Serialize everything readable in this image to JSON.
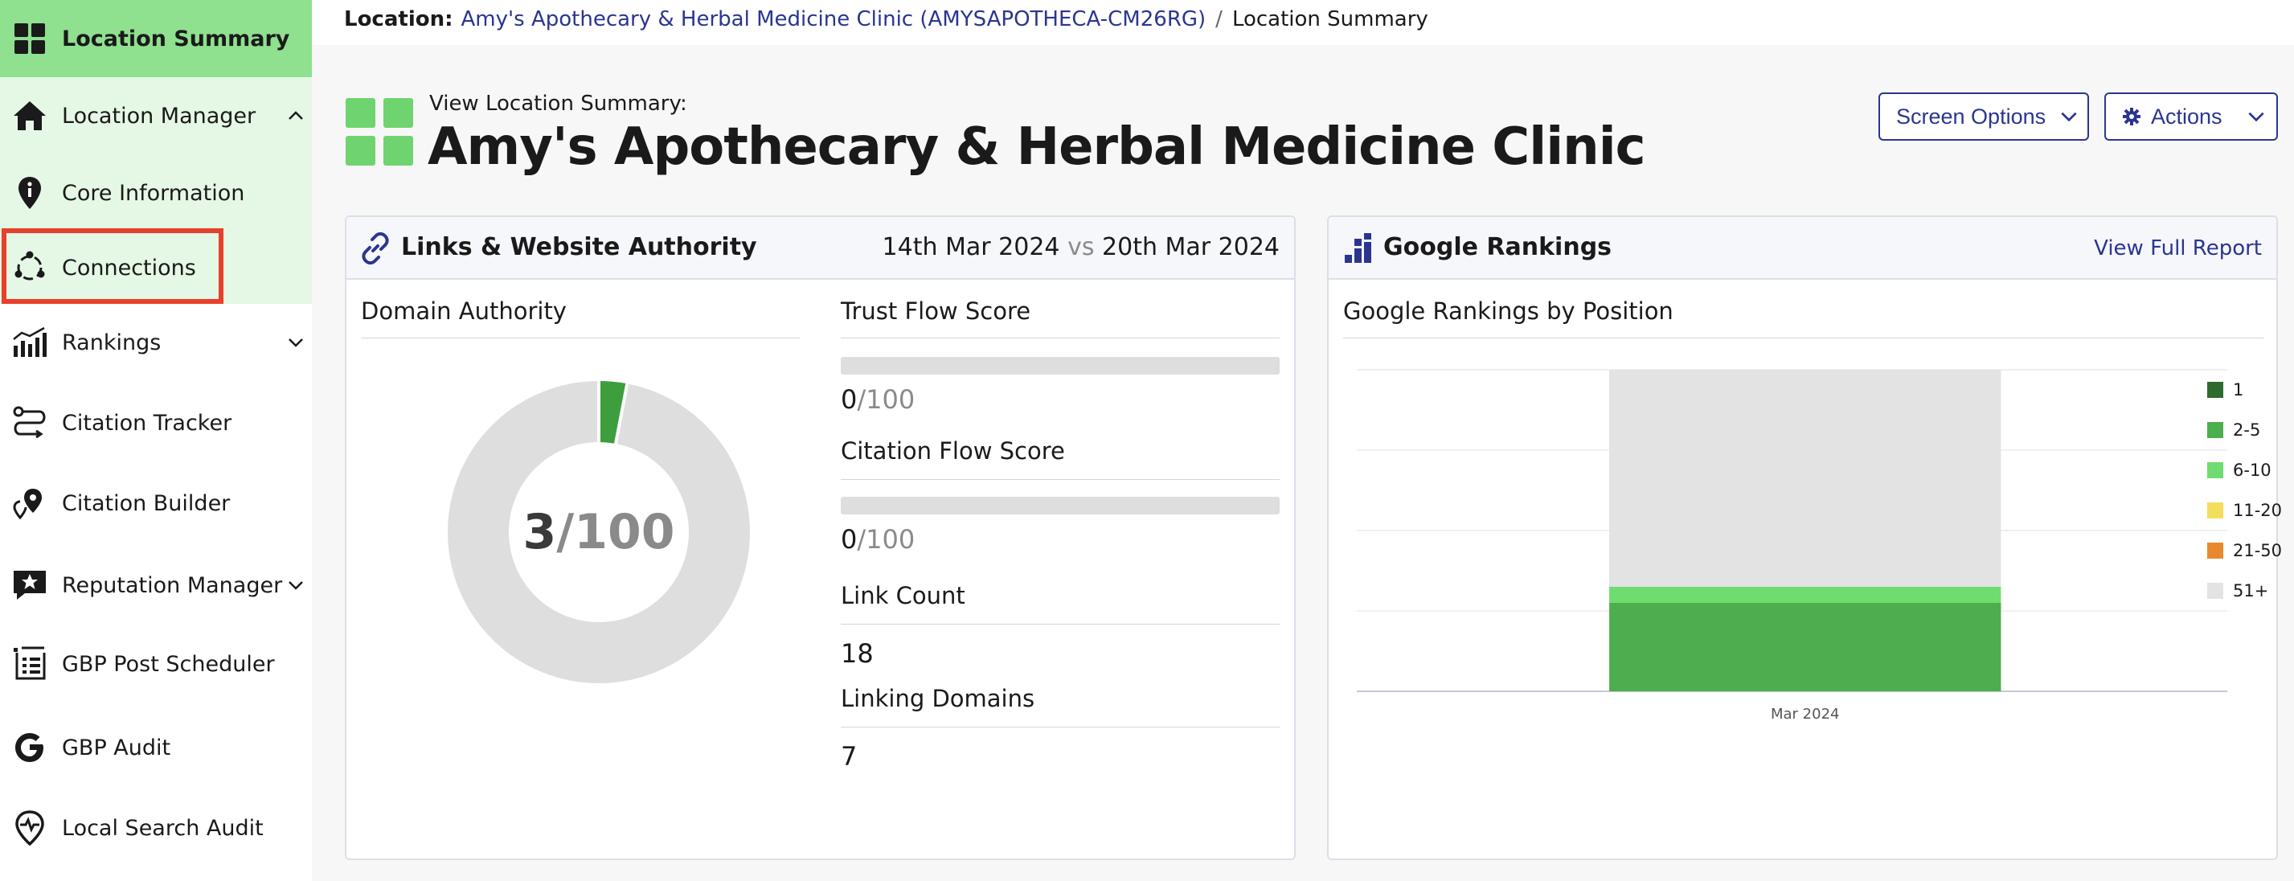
{
  "sidebar": {
    "items": [
      {
        "label": "Location Summary",
        "icon": "dashboard-grid-icon"
      },
      {
        "label": "Location Manager",
        "icon": "home-icon"
      },
      {
        "label": "Core Information",
        "icon": "info-pin-icon"
      },
      {
        "label": "Connections",
        "icon": "connections-icon"
      },
      {
        "label": "Rankings",
        "icon": "rankings-bars-icon"
      },
      {
        "label": "Citation Tracker",
        "icon": "citation-route-icon"
      },
      {
        "label": "Citation Builder",
        "icon": "location-pins-icon"
      },
      {
        "label": "Reputation Manager",
        "icon": "star-message-icon"
      },
      {
        "label": "GBP Post Scheduler",
        "icon": "post-list-icon"
      },
      {
        "label": "GBP Audit",
        "icon": "google-g-icon"
      },
      {
        "label": "Local Search Audit",
        "icon": "pulse-pin-icon"
      }
    ]
  },
  "breadcrumb": {
    "label": "Location:",
    "location_link": "Amy's Apothecary & Herbal Medicine Clinic (AMYSAPOTHECA-CM26RG)",
    "separator": "/",
    "current": "Location Summary"
  },
  "header": {
    "subtitle": "View Location Summary:",
    "title": "Amy's Apothecary & Herbal Medicine Clinic",
    "screen_options_label": "Screen Options",
    "actions_label": "Actions"
  },
  "links_card": {
    "title": "Links & Website Authority",
    "date_from": "14th Mar 2024",
    "vs": "vs",
    "date_to": "20th Mar 2024",
    "domain_authority": {
      "label": "Domain Authority",
      "value": "3",
      "denominator": "/100",
      "fraction": 0.03
    },
    "trust_flow": {
      "label": "Trust Flow Score",
      "value": "0",
      "denominator": "/100",
      "fraction": 0
    },
    "citation_flow": {
      "label": "Citation Flow Score",
      "value": "0",
      "denominator": "/100",
      "fraction": 0
    },
    "link_count": {
      "label": "Link Count",
      "value": "18"
    },
    "linking_domains": {
      "label": "Linking Domains",
      "value": "7"
    }
  },
  "rankings_card": {
    "title": "Google Rankings",
    "view_full_report": "View Full Report",
    "chart_title": "Google Rankings by Position"
  },
  "colors": {
    "accent_green": "#8fe08f",
    "light_green": "#e5f8e5",
    "brand_navy": "#2b3590",
    "highlight_red": "#e8402a"
  },
  "chart_data": {
    "type": "bar",
    "stacked": true,
    "categories": [
      "Mar 2024"
    ],
    "series": [
      {
        "name": "1",
        "color": "#2e6b2e",
        "values": [
          0
        ]
      },
      {
        "name": "2-5",
        "color": "#4cae4c",
        "values": [
          11
        ]
      },
      {
        "name": "6-10",
        "color": "#6fdc6f",
        "values": [
          2
        ]
      },
      {
        "name": "11-20",
        "color": "#f2de5c",
        "values": [
          0
        ]
      },
      {
        "name": "21-50",
        "color": "#e8892f",
        "values": [
          0
        ]
      },
      {
        "name": "51+",
        "color": "#e3e3e3",
        "values": [
          27
        ]
      }
    ],
    "ylim": [
      0,
      40
    ],
    "grid": true,
    "legend": "right"
  }
}
